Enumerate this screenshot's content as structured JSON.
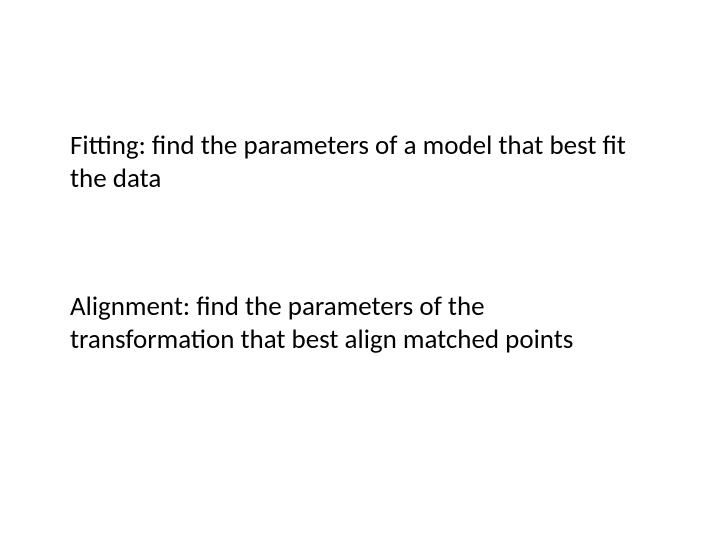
{
  "slide": {
    "paragraphs": [
      "Fitting: find the parameters of a model that best fit the data",
      "Alignment: find the parameters of the transformation that best align matched points"
    ]
  }
}
